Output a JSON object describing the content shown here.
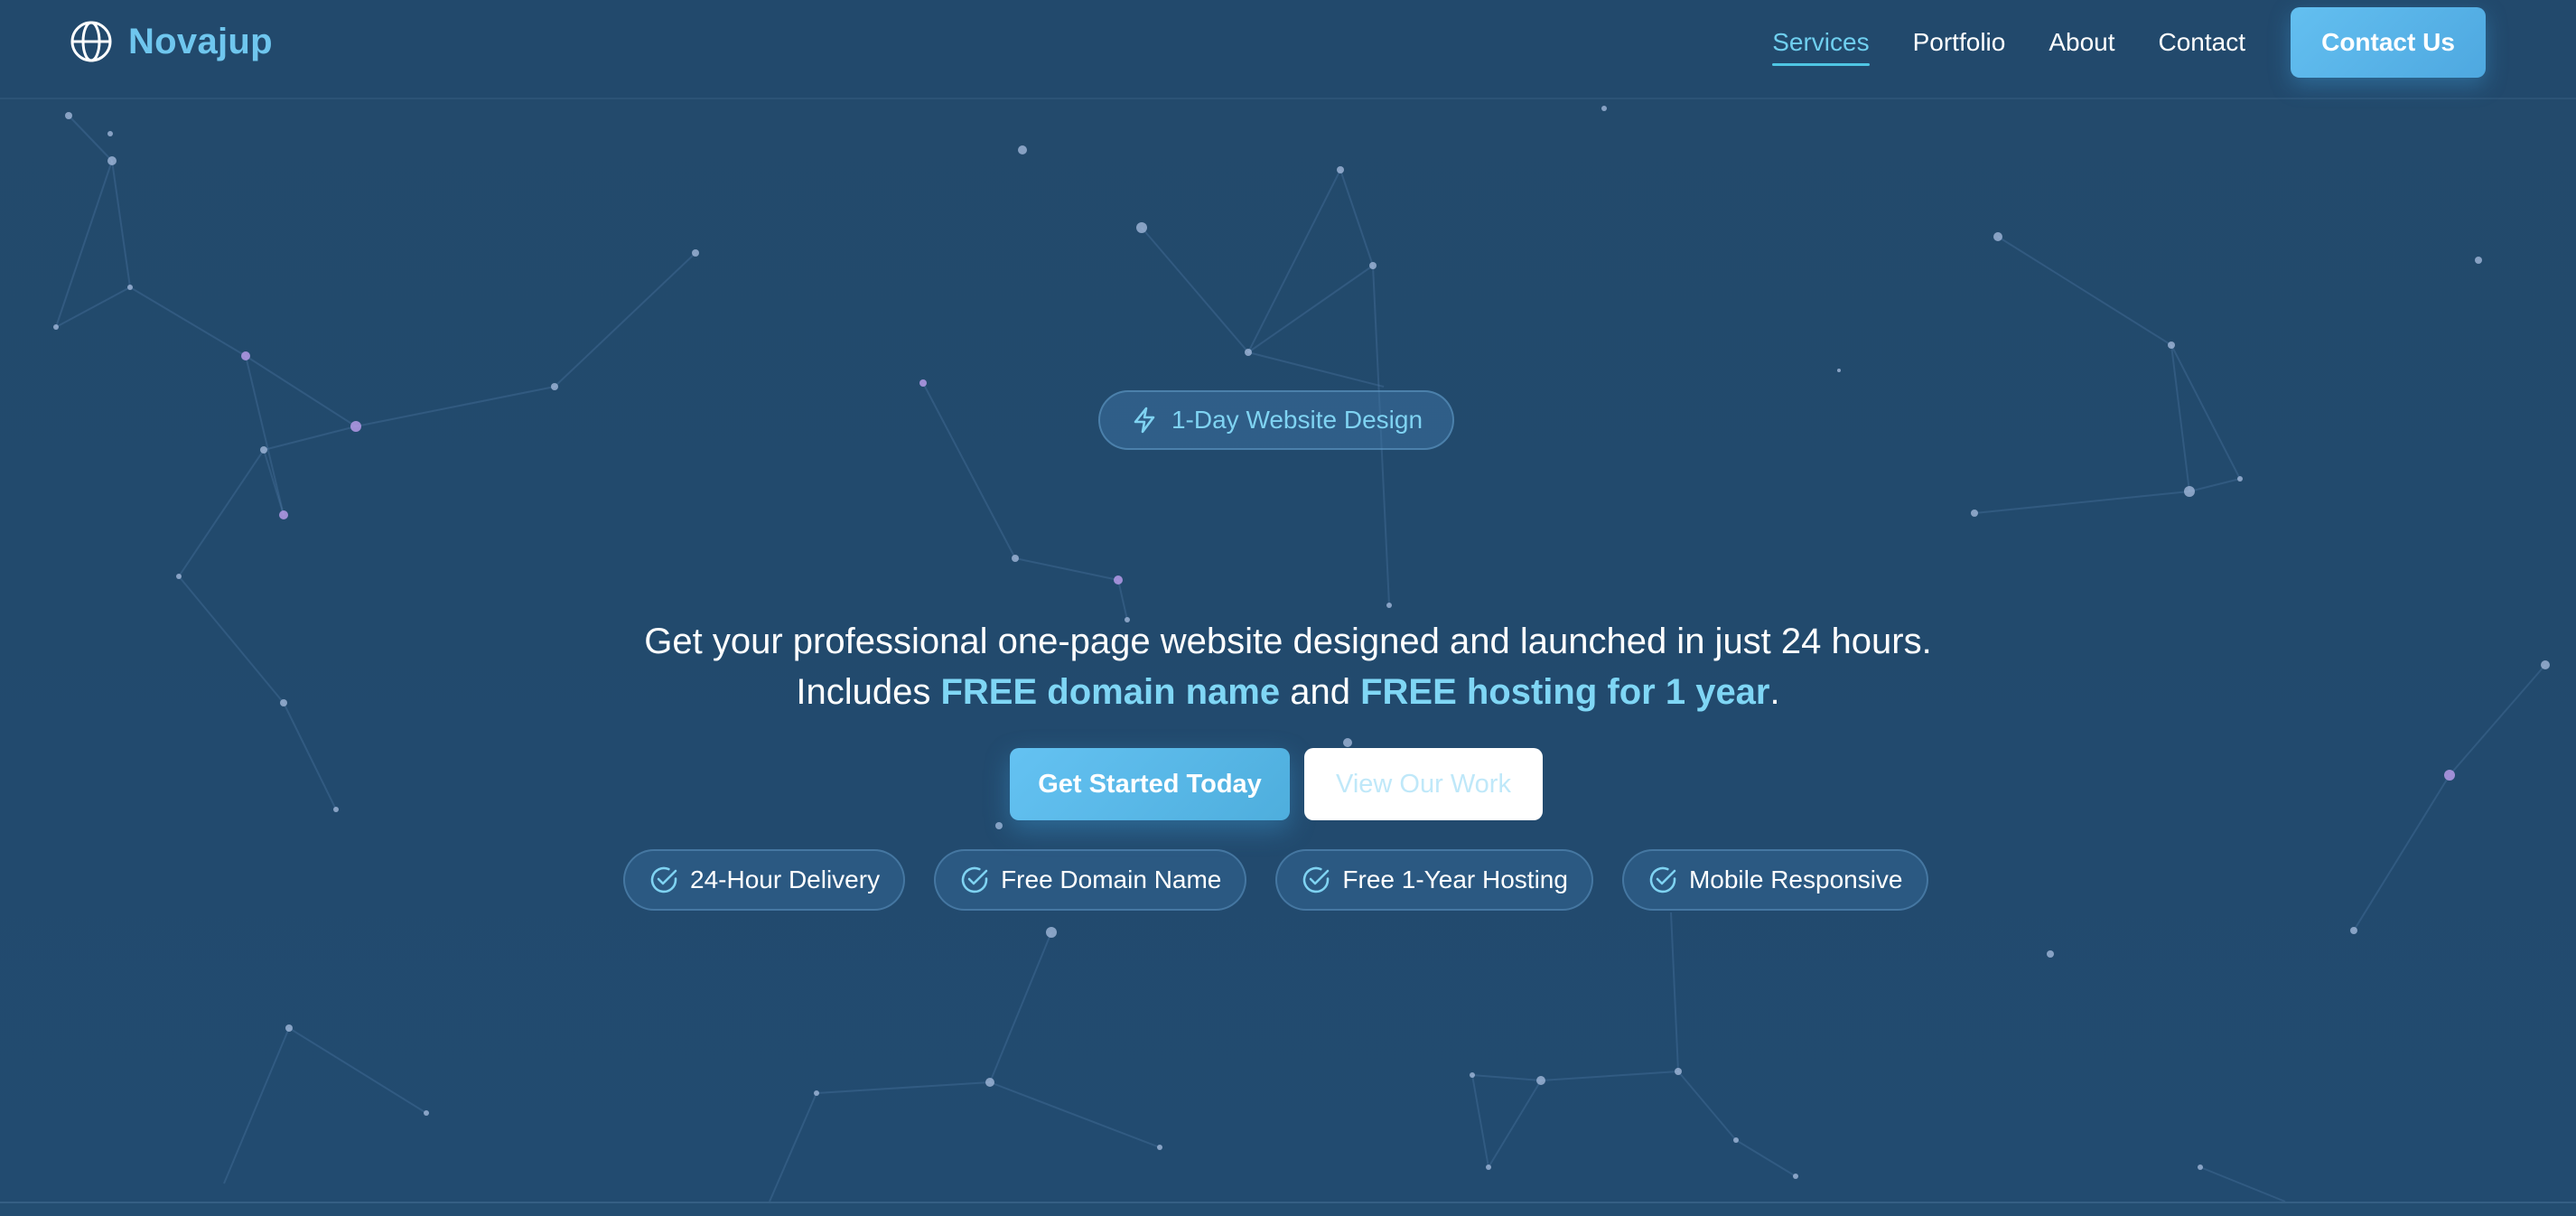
{
  "brand": {
    "name": "Novajup",
    "icon": "globe-icon",
    "color": "#6fc6ee"
  },
  "nav": {
    "items": [
      {
        "label": "Services",
        "active": true
      },
      {
        "label": "Portfolio",
        "active": false
      },
      {
        "label": "About",
        "active": false
      },
      {
        "label": "Contact",
        "active": false
      }
    ],
    "cta_label": "Contact Us"
  },
  "hero": {
    "badge": {
      "label": "1-Day Website Design",
      "icon": "lightning-icon"
    },
    "line1": "Get your professional one-page website designed and launched in just 24 hours.",
    "line2_prefix": "Includes ",
    "line2_highlight1": "FREE domain name",
    "line2_middle": " and ",
    "line2_highlight2": "FREE hosting for 1 year",
    "line2_suffix": ".",
    "primary_cta": "Get Started Today",
    "secondary_cta": "View Our Work",
    "features": [
      {
        "label": "24-Hour Delivery",
        "icon": "check-circle-icon"
      },
      {
        "label": "Free Domain Name",
        "icon": "check-circle-icon"
      },
      {
        "label": "Free 1-Year Hosting",
        "icon": "check-circle-icon"
      },
      {
        "label": "Mobile Responsive",
        "icon": "check-circle-icon"
      }
    ]
  },
  "colors": {
    "background": "#234a6c",
    "accent": "#63bff0",
    "highlight_text": "#7fd6f5",
    "active_nav": "#6fcfef"
  }
}
